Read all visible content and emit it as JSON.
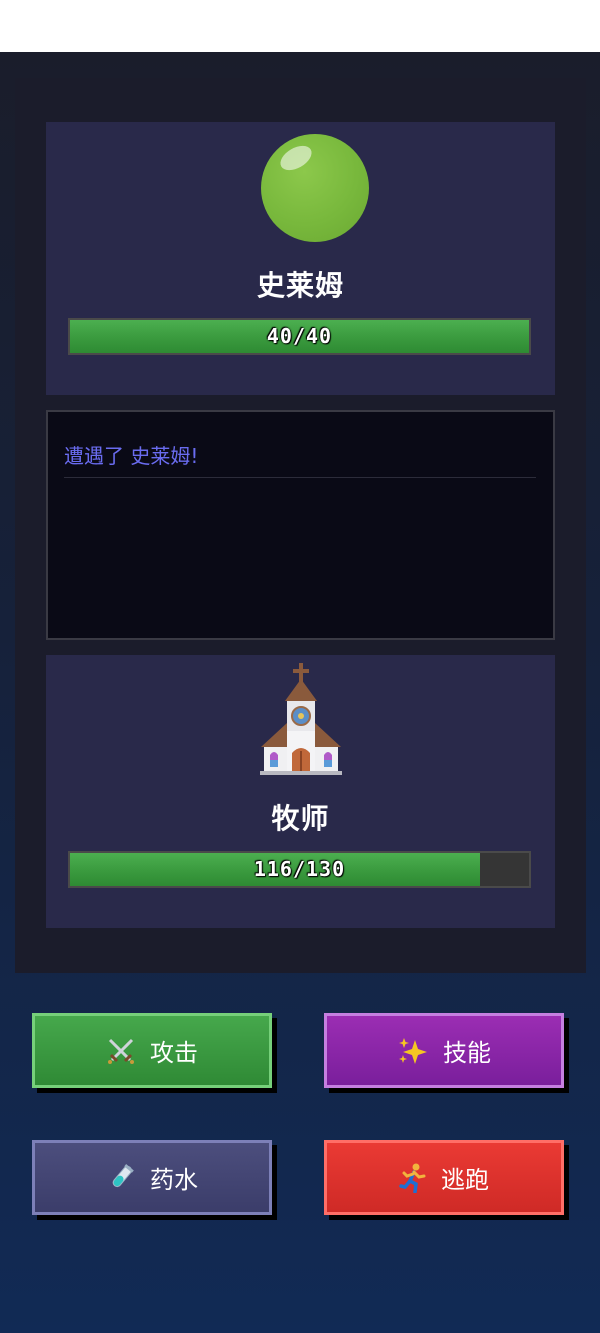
{
  "enemy": {
    "name": "史莱姆",
    "hp_text": "40/40",
    "hp_fraction": 1.0,
    "icon": "slime-icon"
  },
  "log": {
    "lines": [
      "遭遇了 史莱姆!"
    ]
  },
  "player": {
    "name": "牧师",
    "hp_text": "116/130",
    "hp_fraction": 0.8923,
    "icon": "church-icon"
  },
  "actions": {
    "attack": {
      "label": "攻击",
      "icon": "crossed-swords-icon"
    },
    "skill": {
      "label": "技能",
      "icon": "sparkles-icon"
    },
    "potion": {
      "label": "药水",
      "icon": "test-tube-icon"
    },
    "flee": {
      "label": "逃跑",
      "icon": "running-person-icon"
    }
  },
  "colors": {
    "hp_bar": "#3a9a3e",
    "attack": "#3b9a41",
    "skill": "#8a26a8",
    "potion": "#434572",
    "flee": "#de322d",
    "log_text": "#6a6cf0"
  }
}
